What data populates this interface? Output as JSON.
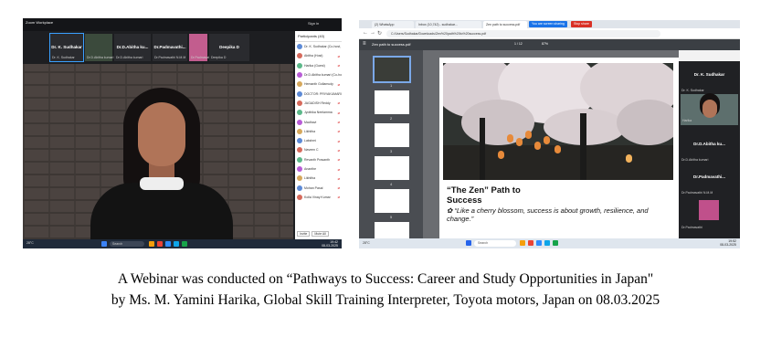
{
  "left": {
    "app": "Zoom Workplace",
    "sign": "Sign in",
    "tiles": [
      {
        "name": "Dr. K. Sudhakar",
        "sub": "Dr. K. Sudhakar"
      },
      {
        "name": "",
        "sub": "Dr.D.Abitha kumari"
      },
      {
        "name": "Dr.D.Abitha ku...",
        "sub": "Dr.D.Abitha kumari"
      },
      {
        "name": "Dr.Padmavathi...",
        "sub": "Dr.Padmavathi N.M.M"
      },
      {
        "name": "",
        "sub": "Dr.Padmavathi"
      },
      {
        "name": "Deepika D",
        "sub": "Deepika D"
      }
    ],
    "panel_title": "Participants (40)",
    "participants": [
      "Dr. K. Sudhakar (Co-host, me)",
      "Abitha (Host)",
      "Harika (Guest)",
      "Dr.D.Abitha kumari (Co-host)",
      "Hemanth Gollamudy",
      "DOCTOR: PRIYAKUMARI",
      "JAGADISH Reddy",
      "Jyothika Neelamma",
      "Madhavi",
      "Likhitha",
      "Lakshmi",
      "Naveen C",
      "Revanth Prasanth",
      "Ananthe",
      "Likhitha",
      "Mohan Pasal",
      "Kolla Vinay Kumar"
    ],
    "invite": "Invite",
    "muteall": "Mute All",
    "search": "Search",
    "time": "19:42",
    "date": "08-03-2025",
    "weather": "28°C"
  },
  "right": {
    "tabs": [
      "(2) WhatsApp",
      "Inbox (10,742) - sudhakar...",
      "Zen path to success.pdf"
    ],
    "sharing": "You are screen sharing",
    "stop": "Stop share",
    "url": "C:/Users/Sudhakar/Downloads/Zen%20path%20to%20success.pdf",
    "pdf_name": "Zen path to success.pdf",
    "page_info": "1 / 12",
    "zoom": "87%",
    "slide_heading": "“The Zen” Path to Success",
    "slide_quote": "✿ “Like a cherry blossom, success is about growth, resilience, and change.”",
    "thumb_numbers": [
      "1",
      "2",
      "3",
      "4",
      "5",
      "6"
    ],
    "meet": [
      {
        "name": "Dr. K. Sudhakar",
        "sub": "Dr. K. Sudhakar"
      },
      {
        "name": "",
        "sub": "Harika"
      },
      {
        "name": "Dr.D.Abitha ku...",
        "sub": "Dr.D.Abitha kumari"
      },
      {
        "name": "Dr.Padmavathi...",
        "sub": "Dr.Padmavathi N.M.M"
      },
      {
        "name": "",
        "sub": "Dr.Padmavathi"
      }
    ],
    "search": "Search",
    "time": "19:52",
    "date": "08-03-2025",
    "weather": "28°C"
  },
  "caption": {
    "line1": "A Webinar was conducted on “Pathways to Success: Career and Study Opportunities in Japan\"",
    "line2": "by Ms. M. Yamini Harika, Global Skill Training Interpreter, Toyota motors, Japan on 08.03.2025"
  }
}
